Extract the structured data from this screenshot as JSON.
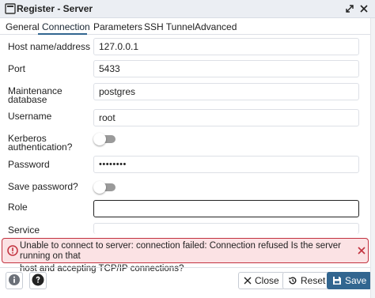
{
  "window": {
    "title": "Register - Server"
  },
  "tabs": [
    {
      "label": "General",
      "active": false
    },
    {
      "label": "Connection",
      "active": true
    },
    {
      "label": "Parameters",
      "active": false
    },
    {
      "label": "SSH Tunnel",
      "active": false
    },
    {
      "label": "Advanced",
      "active": false
    }
  ],
  "form": {
    "host": {
      "label": "Host name/address",
      "value": "127.0.0.1"
    },
    "port": {
      "label": "Port",
      "value": "5433"
    },
    "maintenance_db": {
      "label_line1": "Maintenance",
      "label_line2": "database",
      "value": "postgres"
    },
    "username": {
      "label": "Username",
      "value": "root"
    },
    "kerberos": {
      "label_line1": "Kerberos",
      "label_line2": "authentication?",
      "checked": false
    },
    "password": {
      "label": "Password",
      "value": "••••••••"
    },
    "save_password": {
      "label": "Save password?",
      "checked": false
    },
    "role": {
      "label": "Role",
      "value": ""
    },
    "service": {
      "label": "Service",
      "value": ""
    }
  },
  "error": {
    "line1": "Unable to connect to server: connection failed: Connection refused Is the server running on that",
    "line2": "host and accepting TCP/IP connections?",
    "color": "#c2313e"
  },
  "footer": {
    "close_label": "Close",
    "reset_label": "Reset",
    "save_label": "Save"
  },
  "colors": {
    "accent": "#326690",
    "error_bg": "#fbe2e4"
  }
}
